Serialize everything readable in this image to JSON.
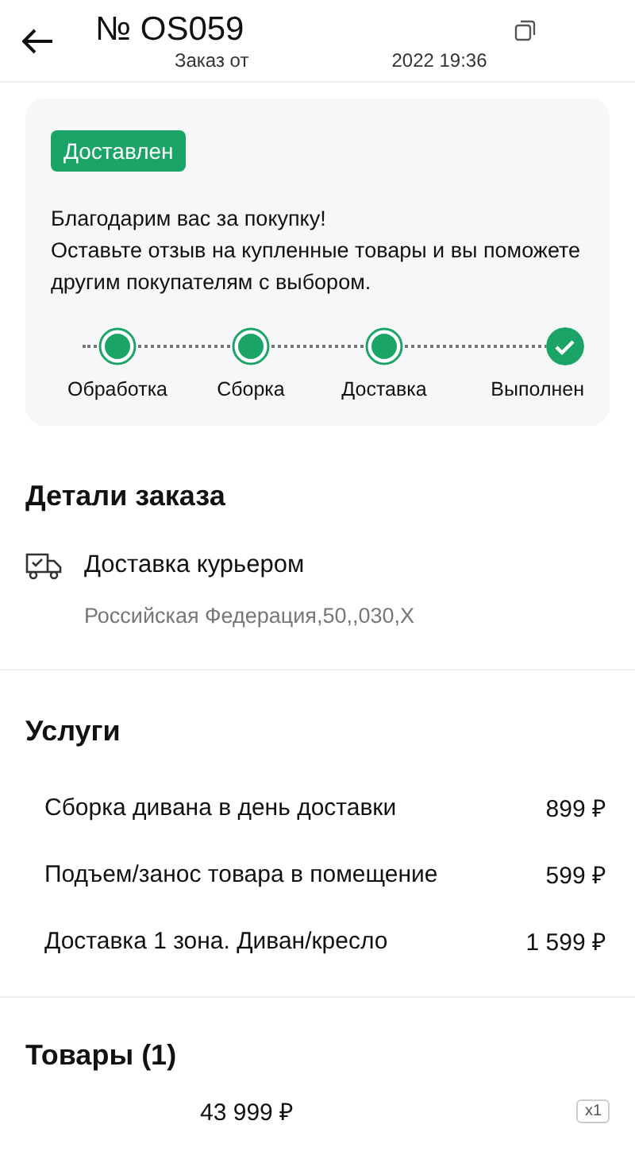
{
  "header": {
    "title": "№ OS059",
    "subtitle_start": "Заказ от",
    "subtitle_end": "2022 19:36"
  },
  "status_card": {
    "badge": "Доставлен",
    "message": "Благодарим вас за покупку!\nОставьте отзыв на купленные товары и вы поможете другим покупателям с выбором.",
    "steps": [
      {
        "label": "Обработка",
        "done": true,
        "kind": "dot"
      },
      {
        "label": "Сборка",
        "done": true,
        "kind": "dot"
      },
      {
        "label": "Доставка",
        "done": true,
        "kind": "dot"
      },
      {
        "label": "Выполнен",
        "done": true,
        "kind": "check"
      }
    ]
  },
  "details": {
    "title": "Детали заказа",
    "delivery_method": "Доставка курьером",
    "address": "Российская Федерация,50,,030,Х"
  },
  "services": {
    "title": "Услуги",
    "items": [
      {
        "name": "Сборка дивана в день доставки",
        "price": "899 ₽"
      },
      {
        "name": "Подъем/занос товара в помещение",
        "price": "599 ₽"
      },
      {
        "name": "Доставка 1 зона. Диван/кресло",
        "price": "1 599 ₽"
      }
    ]
  },
  "products": {
    "title": "Товары (1)",
    "items": [
      {
        "price": "43 999 ₽",
        "quantity": "x1"
      }
    ]
  }
}
